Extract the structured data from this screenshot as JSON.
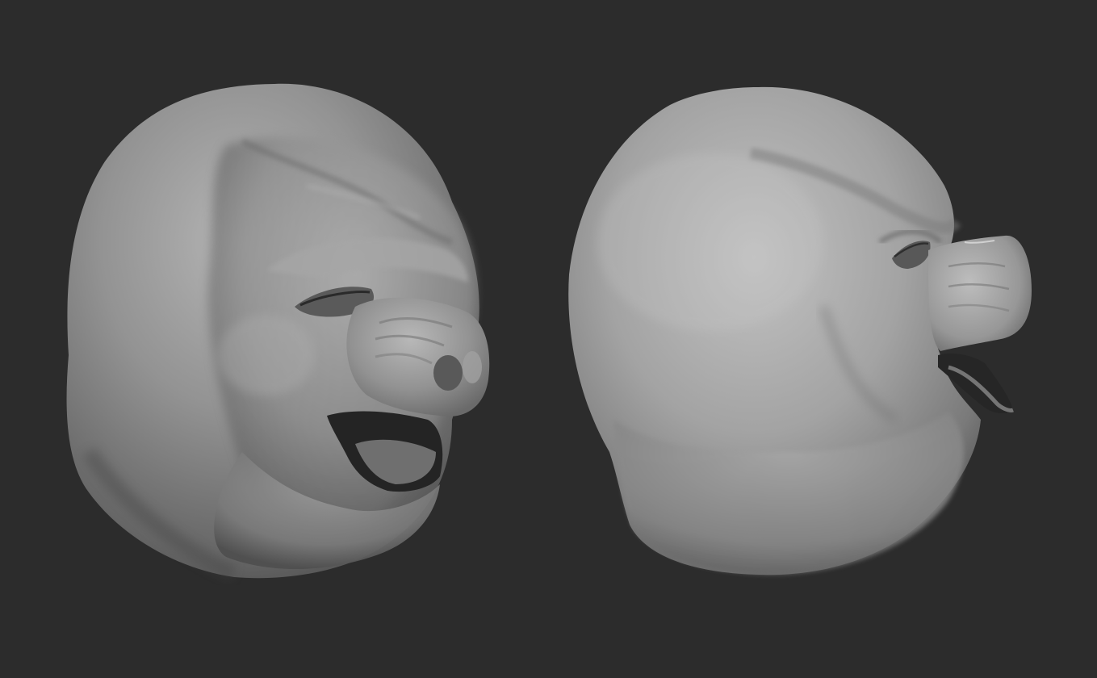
{
  "viewport": {
    "background_color": "#2c2c2c",
    "material_colors": {
      "highlight": "#bdbdbd",
      "mid": "#8c8c8c",
      "shadow": "#4a4a4a",
      "cavity": "#1e1e1e"
    }
  },
  "models": [
    {
      "name": "pig-head-sculpt-three-quarter-view",
      "view": "three-quarter"
    },
    {
      "name": "pig-head-sculpt-profile-view",
      "view": "profile"
    }
  ]
}
